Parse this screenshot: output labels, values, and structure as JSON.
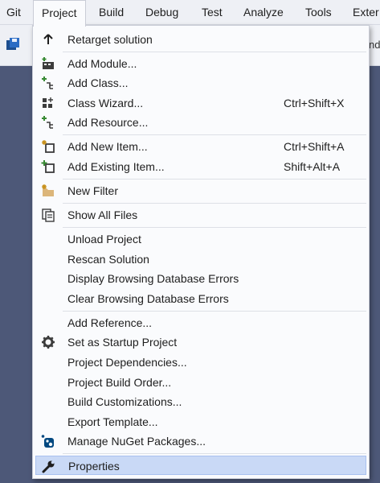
{
  "menubar": {
    "items": [
      "Git",
      "Project",
      "Build",
      "Debug",
      "Test",
      "Analyze",
      "Tools",
      "Exter"
    ]
  },
  "toolbar": {
    "partial_text": "nd",
    "save_icon": "save-all-icon"
  },
  "menu": {
    "items": [
      {
        "label": "Retarget solution",
        "shortcut": "",
        "icon": "arrow-up-icon"
      },
      {
        "label": "Add Module...",
        "shortcut": "",
        "icon": "add-module-icon"
      },
      {
        "label": "Add Class...",
        "shortcut": "",
        "icon": "add-class-icon"
      },
      {
        "label": "Class Wizard...",
        "shortcut": "Ctrl+Shift+X",
        "icon": "class-wizard-icon"
      },
      {
        "label": "Add Resource...",
        "shortcut": "",
        "icon": "add-resource-icon"
      },
      {
        "label": "Add New Item...",
        "shortcut": "Ctrl+Shift+A",
        "icon": "add-new-item-icon"
      },
      {
        "label": "Add Existing Item...",
        "shortcut": "Shift+Alt+A",
        "icon": "add-existing-item-icon"
      },
      {
        "label": "New Filter",
        "shortcut": "",
        "icon": "new-filter-folder-icon"
      },
      {
        "label": "Show All Files",
        "shortcut": "",
        "icon": "show-all-files-icon"
      },
      {
        "label": "Unload Project",
        "shortcut": "",
        "icon": ""
      },
      {
        "label": "Rescan Solution",
        "shortcut": "",
        "icon": ""
      },
      {
        "label": "Display Browsing Database Errors",
        "shortcut": "",
        "icon": ""
      },
      {
        "label": "Clear Browsing Database Errors",
        "shortcut": "",
        "icon": ""
      },
      {
        "label": "Add Reference...",
        "shortcut": "",
        "icon": ""
      },
      {
        "label": "Set as Startup Project",
        "shortcut": "",
        "icon": "gear-icon"
      },
      {
        "label": "Project Dependencies...",
        "shortcut": "",
        "icon": ""
      },
      {
        "label": "Project Build Order...",
        "shortcut": "",
        "icon": ""
      },
      {
        "label": "Build Customizations...",
        "shortcut": "",
        "icon": ""
      },
      {
        "label": "Export Template...",
        "shortcut": "",
        "icon": ""
      },
      {
        "label": "Manage NuGet Packages...",
        "shortcut": "",
        "icon": "nuget-icon"
      },
      {
        "label": "Properties",
        "shortcut": "",
        "icon": "wrench-icon",
        "highlighted": true
      }
    ]
  },
  "colors": {
    "menu_bg": "#fafbfd",
    "highlight": "#c9d9f6",
    "workspace": "#4d5878",
    "accent_green": "#388a34",
    "accent_blue": "#1e6fbf"
  }
}
